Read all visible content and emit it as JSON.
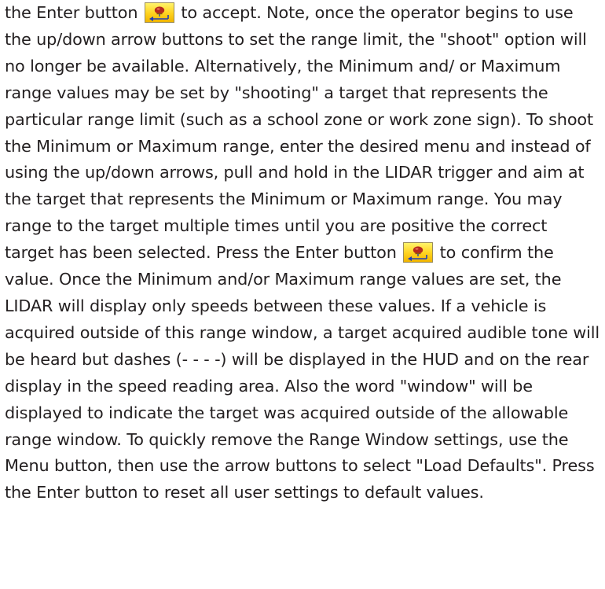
{
  "document": {
    "paragraph": {
      "seg1": "the Enter button",
      "seg2": "to accept. Note, once the operator begins to use the up/down arrow buttons to set the range limit, the \"shoot\" option will no longer be available. Alternatively, the Minimum and/ or Maximum range values may be set by \"shooting\" a target that represents the particular range limit (such as a school zone or work zone sign). To shoot the Minimum or Maximum range, enter the desired menu and instead of using the up/down arrows, pull and hold in the LIDAR trigger and aim at the target that represents the Minimum or Maximum range. You may range to the target multiple times until you are positive the correct target has been selected. Press the Enter button",
      "seg3": "to confirm the value. Once the Minimum and/or Maximum range values are set, the LIDAR will display only speeds between these values. If a vehicle is acquired outside of this range window, a target acquired audible tone will be heard but dashes (- - - -) will be displayed in the HUD and on the rear display in the speed reading area. Also the word \"window\" will be displayed to indicate the target was acquired outside of the allowable range window. To quickly remove the Range Window settings, use the Menu button, then use the arrow buttons to select \"Load Defaults\". Press the Enter button to reset all user settings to default values."
    },
    "icons": {
      "enter_button_icon": "enter-button-icon"
    },
    "colors": {
      "text": "#231f20",
      "icon_fill": "#ffd21e",
      "icon_arrow": "#1f3fb5",
      "icon_dome": "#b52a1d"
    }
  }
}
